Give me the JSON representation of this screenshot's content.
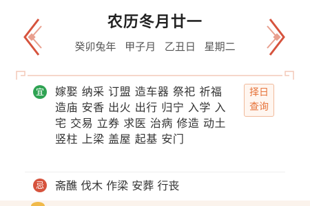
{
  "header": {
    "title": "农历冬月廿一",
    "subtitle": "癸卯兔年  甲子月  乙丑日  星期二"
  },
  "good": {
    "badge": "宜",
    "text": "嫁娶 纳采 订盟 造车器 祭祀 祈福 造庙 安香 出火 出行 归宁 入学 入宅 交易 立券 求医 治病 修造 动土 竖柱 上梁 盖屋 起基 安门"
  },
  "select_day_button": "择日\n查询",
  "bad": {
    "badge": "忌",
    "text": "斋醮 伐木 作梁 安葬 行丧"
  },
  "colors": {
    "accent_red": "#d6533d",
    "good_green": "#2fa353",
    "button_orange": "#e6733a"
  }
}
